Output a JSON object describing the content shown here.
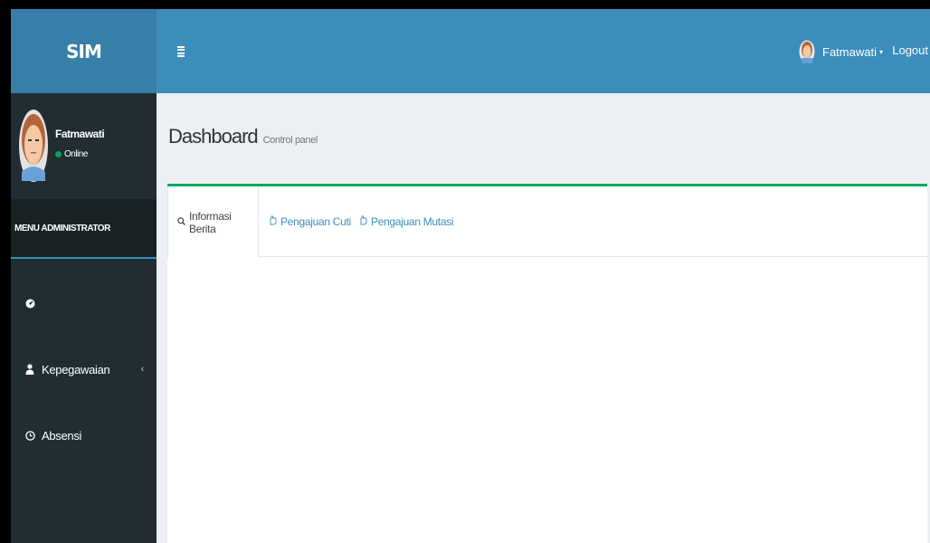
{
  "app": {
    "logo": "SIM"
  },
  "header": {
    "user_name": "Fatmawati",
    "logout_label": "Logout"
  },
  "sidebar": {
    "user": {
      "name": "Fatmawati",
      "status": "Online"
    },
    "menu_header": "MENU ADMINISTRATOR",
    "items": [
      {
        "label": "",
        "icon": "dashboard-icon"
      },
      {
        "label": "Kepegawaian",
        "icon": "user-icon",
        "has_submenu": true
      },
      {
        "label": "Absensi",
        "icon": "clock-icon"
      }
    ]
  },
  "content": {
    "title": "Dashboard",
    "subtitle": "Control panel",
    "tabs": [
      {
        "label": "Informasi Berita",
        "icon": "search-icon",
        "active": true
      },
      {
        "label": "Pengajuan Cuti",
        "icon": "hand-icon",
        "active": false
      },
      {
        "label": "Pengajuan Mutasi",
        "icon": "hand-icon",
        "active": false
      }
    ]
  },
  "colors": {
    "header_bg": "#3c8dbc",
    "logo_bg": "#367fa9",
    "sidebar_bg": "#222d32",
    "box_accent": "#00a65a"
  }
}
